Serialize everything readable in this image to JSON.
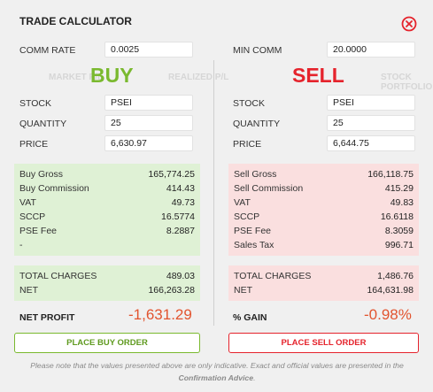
{
  "window": {
    "title": "TRADE CALCULATOR",
    "background_headers": [
      "MARKET P/L",
      "REALIZED P/L",
      "STOCK PORTFOLIO"
    ]
  },
  "settings": {
    "comm_rate_label": "COMM RATE",
    "comm_rate_value": "0.0025",
    "min_comm_label": "MIN COMM",
    "min_comm_value": "20.0000"
  },
  "buy": {
    "heading": "BUY",
    "stock_label": "STOCK",
    "stock_value": "PSEI",
    "quantity_label": "QUANTITY",
    "quantity_value": "25",
    "price_label": "PRICE",
    "price_value": "6,630.97",
    "breakdown": [
      {
        "label": "Buy Gross",
        "value": "165,774.25"
      },
      {
        "label": "Buy Commission",
        "value": "414.43"
      },
      {
        "label": "VAT",
        "value": "49.73"
      },
      {
        "label": "SCCP",
        "value": "16.5774"
      },
      {
        "label": "PSE Fee",
        "value": "8.2887"
      },
      {
        "label": "-",
        "value": ""
      }
    ],
    "totals": [
      {
        "label": "TOTAL CHARGES",
        "value": "489.03"
      },
      {
        "label": "NET",
        "value": "166,263.28"
      }
    ],
    "result_label": "NET PROFIT",
    "result_value": "-1,631.29",
    "button_label": "PLACE BUY ORDER"
  },
  "sell": {
    "heading": "SELL",
    "stock_label": "STOCK",
    "stock_value": "PSEI",
    "quantity_label": "QUANTITY",
    "quantity_value": "25",
    "price_label": "PRICE",
    "price_value": "6,644.75",
    "breakdown": [
      {
        "label": "Sell Gross",
        "value": "166,118.75"
      },
      {
        "label": "Sell Commission",
        "value": "415.29"
      },
      {
        "label": "VAT",
        "value": "49.83"
      },
      {
        "label": "SCCP",
        "value": "16.6118"
      },
      {
        "label": "PSE Fee",
        "value": "8.3059"
      },
      {
        "label": "Sales Tax",
        "value": "996.71"
      }
    ],
    "totals": [
      {
        "label": "TOTAL CHARGES",
        "value": "1,486.76"
      },
      {
        "label": "NET",
        "value": "164,631.98"
      }
    ],
    "result_label": "% GAIN",
    "result_value": "-0.98%",
    "button_label": "PLACE SELL ORDER"
  },
  "disclaimer": {
    "text": "Please note that the values presented above are only indicative. Exact and official values are presented in the",
    "emphasis": "Confirmation Advice",
    "end": "."
  },
  "colors": {
    "buy_green": "#7ab92f",
    "sell_red": "#e5232c",
    "result_orange": "#e2542f"
  },
  "icons": {
    "close": "close-circle-icon"
  }
}
